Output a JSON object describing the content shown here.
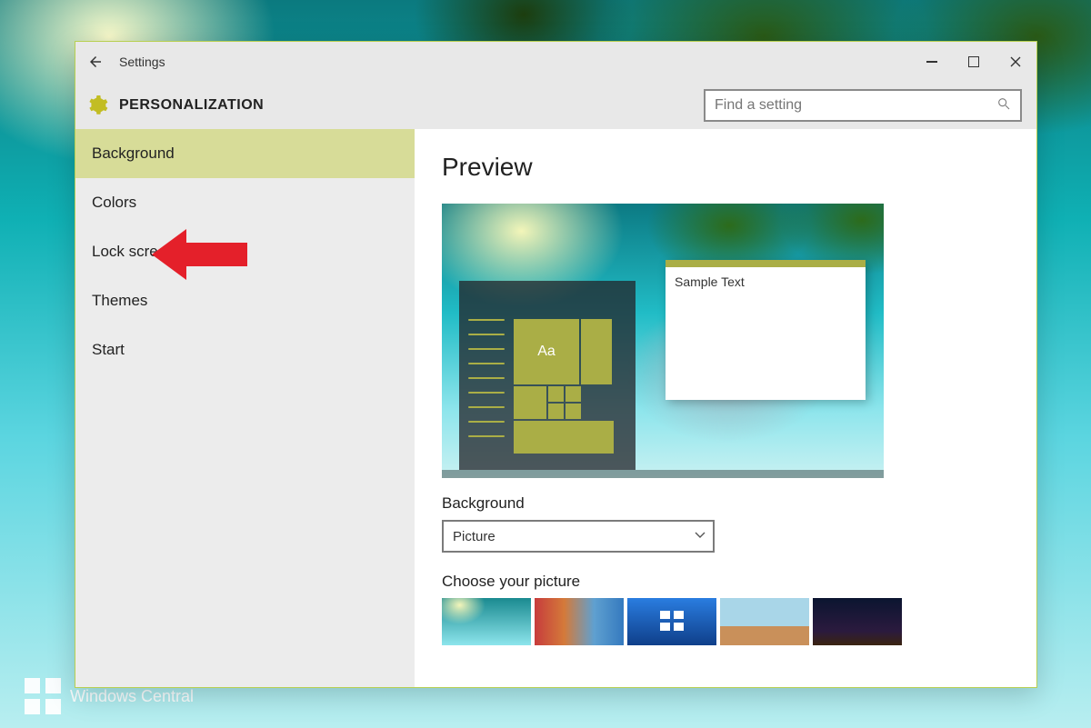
{
  "window": {
    "app_title": "Settings",
    "category": "PERSONALIZATION",
    "search_placeholder": "Find a setting"
  },
  "sidebar": {
    "items": [
      {
        "label": "Background",
        "active": true
      },
      {
        "label": "Colors",
        "active": false
      },
      {
        "label": "Lock screen",
        "active": false
      },
      {
        "label": "Themes",
        "active": false
      },
      {
        "label": "Start",
        "active": false
      }
    ]
  },
  "content": {
    "preview_heading": "Preview",
    "sample_text": "Sample Text",
    "tile_glyph": "Aa",
    "background_label": "Background",
    "background_selected": "Picture",
    "choose_label": "Choose your picture"
  },
  "accent_color": "#aaae46",
  "watermark": "Windows Central"
}
